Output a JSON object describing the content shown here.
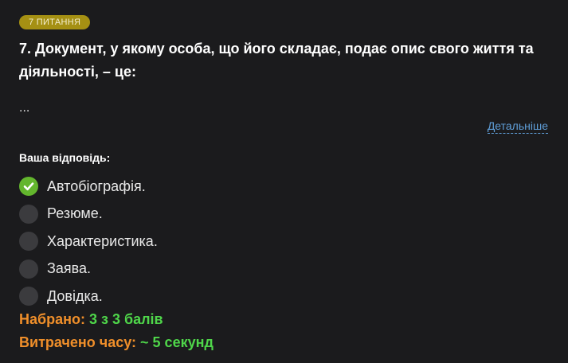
{
  "badge": "7 ПИТАННЯ",
  "question": "7. Документ, у якому особа, що його складає, подає опис свого життя та діяльності, – це:",
  "ellipsis": "...",
  "details_link": "Детальніше",
  "answer_label": "Ваша відповідь:",
  "options": [
    {
      "label": "Автобіографія.",
      "selected": true
    },
    {
      "label": "Резюме.",
      "selected": false
    },
    {
      "label": "Характеристика.",
      "selected": false
    },
    {
      "label": "Заява.",
      "selected": false
    },
    {
      "label": "Довідка.",
      "selected": false
    }
  ],
  "score": {
    "label": "Набрано:",
    "value": "3 з 3 балів"
  },
  "time": {
    "label": "Витрачено часу:",
    "value": "~ 5 секунд"
  },
  "colors": {
    "background": "#1b1b1d",
    "badge": "#a59013",
    "link": "#5f9ed8",
    "correct": "#63b62d",
    "stat_label": "#f08f2a",
    "stat_value": "#4fd64a"
  }
}
